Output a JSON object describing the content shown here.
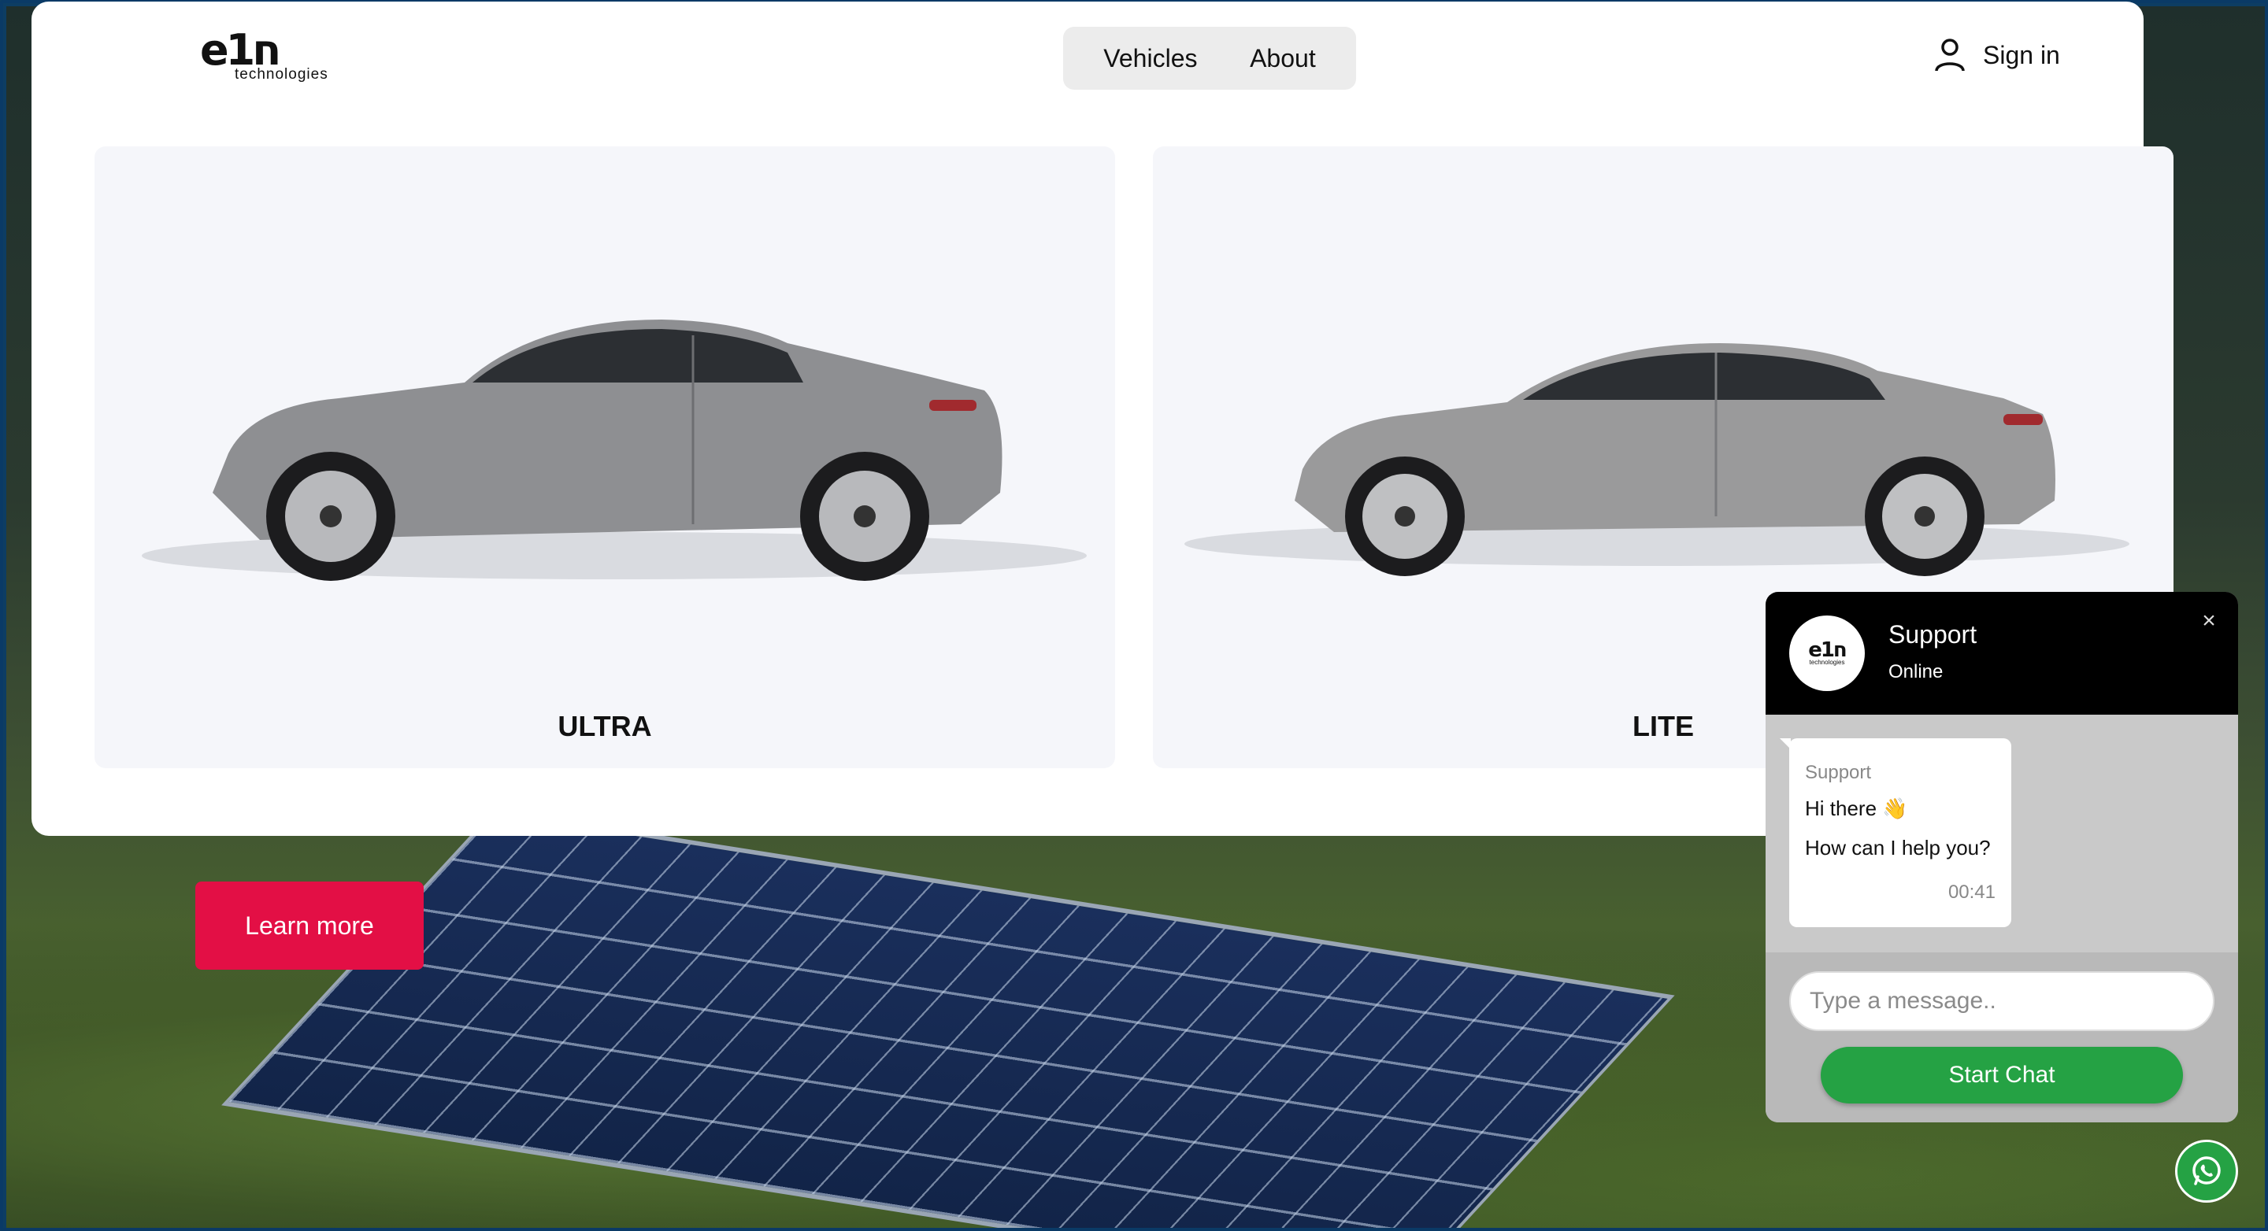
{
  "brand": {
    "logo_mark": "eח1",
    "logo_sub": "technologies"
  },
  "nav": {
    "items": [
      {
        "label": "Vehicles"
      },
      {
        "label": "About"
      }
    ]
  },
  "account": {
    "signin_label": "Sign in",
    "icon": "user-icon"
  },
  "vehicles": [
    {
      "name": "ULTRA",
      "color": "#8c8d90"
    },
    {
      "name": "LITE",
      "color": "#9a9a9b"
    }
  ],
  "hero": {
    "cta_label": "Learn more",
    "cta_color": "#e30f45"
  },
  "chat": {
    "title": "Support",
    "status": "Online",
    "avatar_mark": "eח1",
    "avatar_sub": "technologies",
    "message": {
      "sender": "Support",
      "line1": "Hi there 👋",
      "line2": "How can I help you?",
      "time": "00:41"
    },
    "input_placeholder": "Type a message..",
    "start_label": "Start Chat",
    "accent": "#25a244"
  },
  "whatsapp": {
    "icon": "whatsapp-icon"
  }
}
